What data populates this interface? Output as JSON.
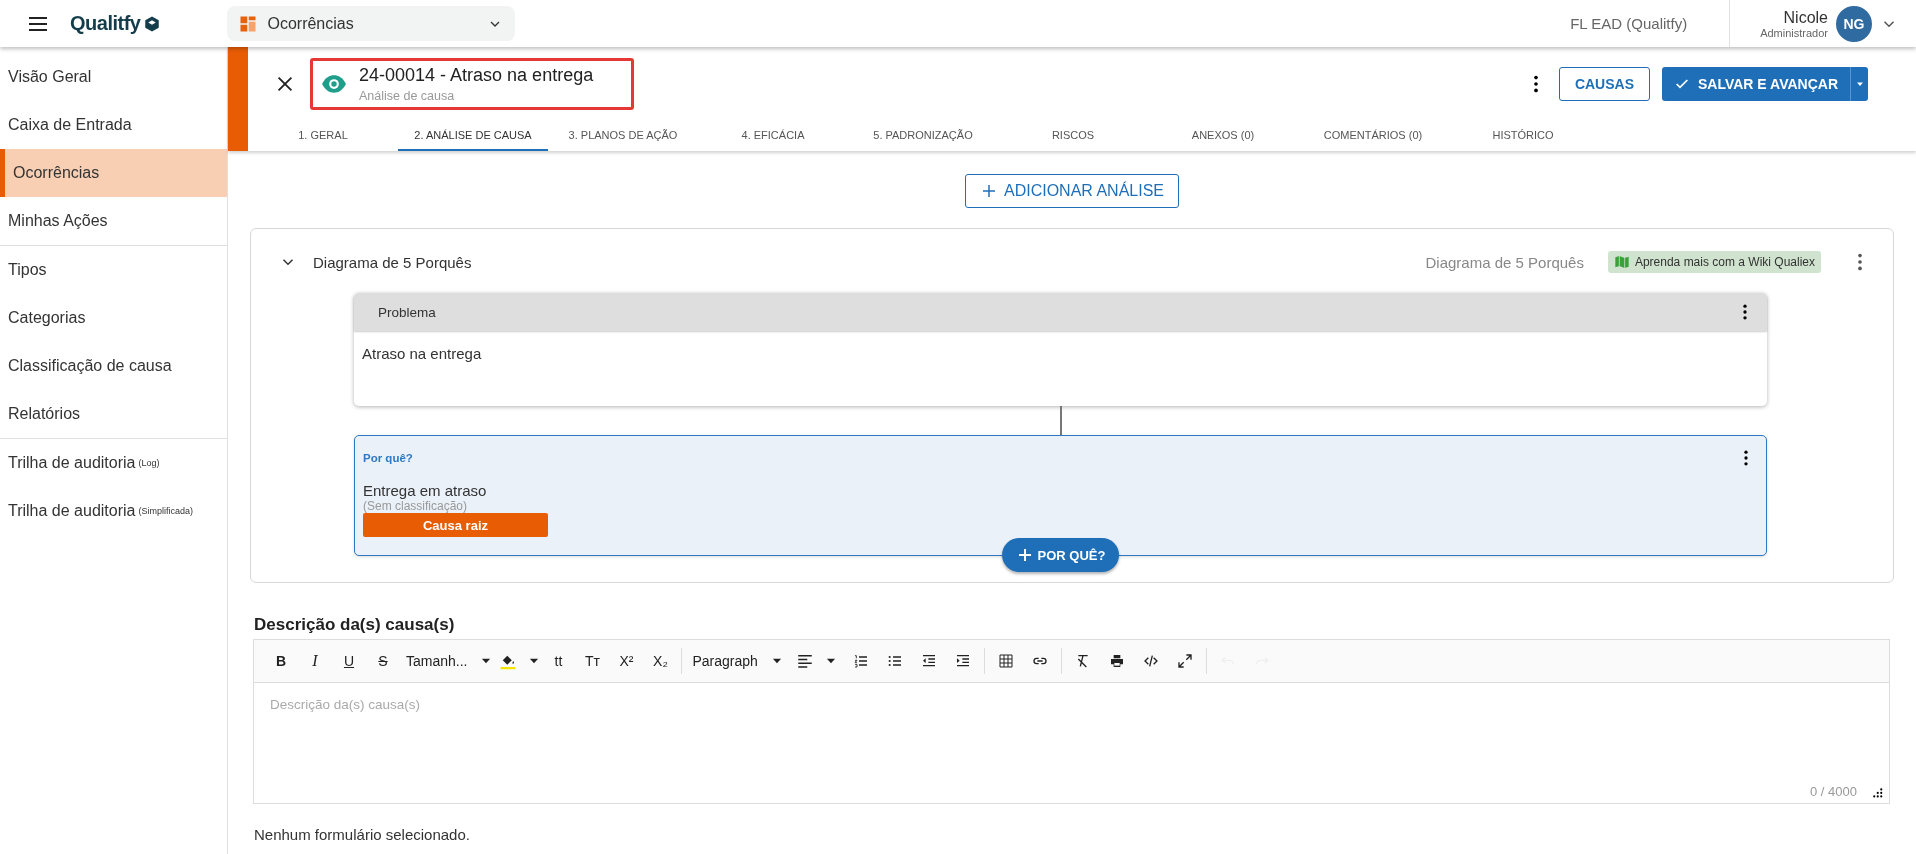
{
  "topbar": {
    "logo": "Qualitfy",
    "module": "Ocorrências",
    "company": "FL EAD (Qualitfy)",
    "user": {
      "name": "Nicole",
      "role": "Administrador",
      "initials": "NG"
    }
  },
  "sidebar": {
    "groups": [
      [
        {
          "label": "Visão Geral",
          "selected": false
        },
        {
          "label": "Caixa de Entrada",
          "selected": false
        },
        {
          "label": "Ocorrências",
          "selected": true
        },
        {
          "label": "Minhas Ações",
          "selected": false
        }
      ],
      [
        {
          "label": "Tipos",
          "selected": false
        },
        {
          "label": "Categorias",
          "selected": false
        },
        {
          "label": "Classificação de causa",
          "selected": false
        },
        {
          "label": "Relatórios",
          "selected": false
        }
      ],
      [
        {
          "label": "Trilha de auditoria",
          "note": "(Log)",
          "selected": false
        },
        {
          "label": "Trilha de auditoria",
          "note": "(Simplificada)",
          "selected": false
        }
      ]
    ]
  },
  "record": {
    "title": "24-00014 - Atraso na entrega",
    "subtitle": "Análise de causa",
    "buttons": {
      "causes": "CAUSAS",
      "save": "SALVAR E AVANÇAR"
    }
  },
  "tabs": [
    {
      "label": "1. GERAL",
      "selected": false
    },
    {
      "label": "2. ANÁLISE DE CAUSA",
      "selected": true
    },
    {
      "label": "3. PLANOS DE AÇÃO",
      "selected": false
    },
    {
      "label": "4. EFICÁCIA",
      "selected": false
    },
    {
      "label": "5. PADRONIZAÇÃO",
      "selected": false
    },
    {
      "label": "RISCOS",
      "selected": false
    },
    {
      "label": "ANEXOS (0)",
      "selected": false
    },
    {
      "label": "COMENTÁRIOS (0)",
      "selected": false
    },
    {
      "label": "HISTÓRICO",
      "selected": false
    }
  ],
  "add_analysis": "ADICIONAR ANÁLISE",
  "analysis": {
    "title": "Diagrama de 5 Porquês",
    "expanded": true,
    "type": "Diagrama de 5 Porquês",
    "wiki": "Aprenda mais com a Wiki Qualiex",
    "problem": {
      "label": "Problema",
      "text": "Atraso na entrega"
    },
    "whys": [
      {
        "label": "Por quê?",
        "text": "Entrega em atraso",
        "classification": "(Sem classificação)",
        "badge": "Causa raiz"
      }
    ],
    "add_why": "POR QUÊ?"
  },
  "description": {
    "title": "Descrição da(s) causa(s)",
    "placeholder": "Descrição da(s) causa(s)",
    "counter": "0 / 4000",
    "toolbar": [
      {
        "kind": "bold",
        "glyph": "B",
        "disabled": false
      },
      {
        "kind": "italic",
        "glyph": "I",
        "disabled": false
      },
      {
        "kind": "underline",
        "glyph": "U",
        "disabled": false
      },
      {
        "kind": "strike",
        "glyph": "S",
        "disabled": false
      },
      {
        "kind": "select",
        "label": "Tamanh...",
        "disabled": false
      },
      {
        "kind": "color",
        "disabled": false
      },
      {
        "kind": "glyph",
        "glyph": "tt",
        "disabled": false
      },
      {
        "kind": "glyph",
        "glyph": "Tт",
        "disabled": false
      },
      {
        "kind": "glyph",
        "glyph": "X²",
        "disabled": false
      },
      {
        "kind": "glyph",
        "glyph": "X₂",
        "disabled": false
      },
      {
        "kind": "separator"
      },
      {
        "kind": "select",
        "label": "Paragraph",
        "disabled": false
      },
      {
        "kind": "align",
        "disabled": false
      },
      {
        "kind": "ordered",
        "disabled": false
      },
      {
        "kind": "bullets",
        "disabled": false
      },
      {
        "kind": "outdent",
        "disabled": false
      },
      {
        "kind": "indent",
        "disabled": false
      },
      {
        "kind": "separator"
      },
      {
        "kind": "table",
        "disabled": false
      },
      {
        "kind": "link",
        "disabled": false
      },
      {
        "kind": "separator"
      },
      {
        "kind": "clear",
        "disabled": false
      },
      {
        "kind": "print",
        "disabled": false
      },
      {
        "kind": "code",
        "disabled": false
      },
      {
        "kind": "fullscreen",
        "disabled": false
      },
      {
        "kind": "separator"
      },
      {
        "kind": "undo",
        "disabled": true
      },
      {
        "kind": "redo",
        "disabled": true
      }
    ]
  },
  "form_note": "Nenhum formulário selecionado."
}
